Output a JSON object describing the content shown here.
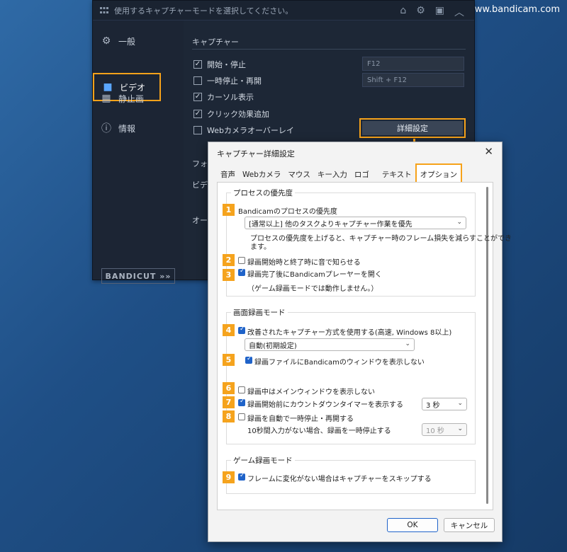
{
  "watermark": "www.bandicam.com",
  "bandicam": {
    "topbar_text": "使用するキャプチャーモードを選択してください。",
    "sidebar": [
      {
        "label": "一般",
        "icon": "gear-icon"
      },
      {
        "label": "ビデオ",
        "icon": "video-camera-icon"
      },
      {
        "label": "静止画",
        "icon": "image-icon"
      },
      {
        "label": "情報",
        "icon": "info-icon"
      }
    ],
    "bandicut": "BANDICUT »»",
    "capture_title": "キャプチャー",
    "options": [
      {
        "label": "開始・停止",
        "checked": true
      },
      {
        "label": "一時停止・再開",
        "checked": false
      },
      {
        "label": "カーソル表示",
        "checked": true
      },
      {
        "label": "クリック効果追加",
        "checked": true
      },
      {
        "label": "Webカメラオーバーレイ",
        "checked": false
      }
    ],
    "hotkeys": [
      "F12",
      "Shift + F12"
    ],
    "detail_button": "詳細設定",
    "format_title": "フォー",
    "video_label": "ビデオ",
    "audio_label": "オーデ"
  },
  "dialog": {
    "title": "キャプチャー詳細設定",
    "close": "✕",
    "tabs": [
      "音声",
      "Webカメラ",
      "マウス",
      "キー入力",
      "ロゴ",
      "テキスト",
      "オプション"
    ],
    "active_tab": "オプション",
    "priority_group": "プロセスの優先度",
    "priority_label": "Bandicamのプロセスの優先度",
    "priority_select": "[通常以上] 他のタスクよりキャプチャー作業を優先",
    "priority_desc_1": "プロセスの優先度を上げると、キャプチャー時のフレーム損失を減らすことができ",
    "priority_desc_2": "ます。",
    "sound_notify": "録画開始時と終了時に音で知らせる",
    "open_player": "録画完了後にBandicamプレーヤーを開く",
    "game_mode_note": "（ゲーム録画モードでは動作しません。）",
    "screen_group": "画面録画モード",
    "improved_capture": "改善されたキャプチャー方式を使用する(高速, Windows 8以上)",
    "auto_select": "自動(初期設定)",
    "hide_window": "録画ファイルにBandicamのウィンドウを表示しない",
    "hide_main": "録画中はメインウィンドウを表示しない",
    "countdown": "録画開始前にカウントダウンタイマーを表示する",
    "countdown_value": "3 秒",
    "auto_pause": "録画を自動で一時停止・再開する",
    "auto_pause_desc": "10秒間入力がない場合、録画を一時停止する",
    "auto_pause_value": "10 秒",
    "game_group": "ゲーム録画モード",
    "skip_frames": "フレームに変化がない場合はキャプチャーをスキップする",
    "ok": "OK",
    "cancel": "キャンセル",
    "badges": [
      "1",
      "2",
      "3",
      "4",
      "5",
      "6",
      "7",
      "8",
      "9"
    ],
    "highlight_color": "#f6a21a"
  }
}
